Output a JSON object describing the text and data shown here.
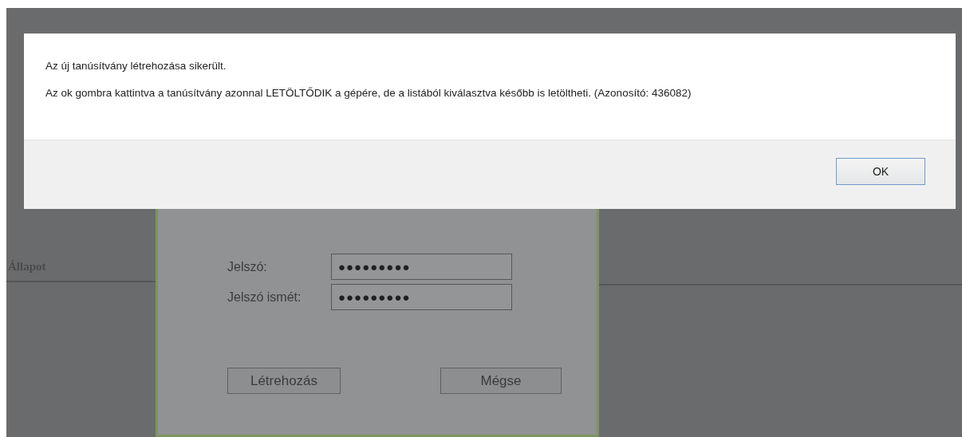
{
  "dialog": {
    "messages": [
      "Az új tanúsítvány létrehozása sikerült.",
      "Az ok gombra kattintva a tanúsítvány azonnal LETÖLTŐDIK a gépére, de a listából kiválasztva később is letöltheti. (Azonosító: 436082)"
    ],
    "buttons": [
      "OK"
    ]
  },
  "background": {
    "column_header": "Állapot",
    "form": {
      "fields": [
        {
          "label": "Jelszó:",
          "value": "●●●●●●●●●"
        },
        {
          "label": "Jelszó ismét:",
          "value": "●●●●●●●●●"
        }
      ],
      "buttons": [
        "Létrehozás",
        "Mégse"
      ]
    }
  }
}
